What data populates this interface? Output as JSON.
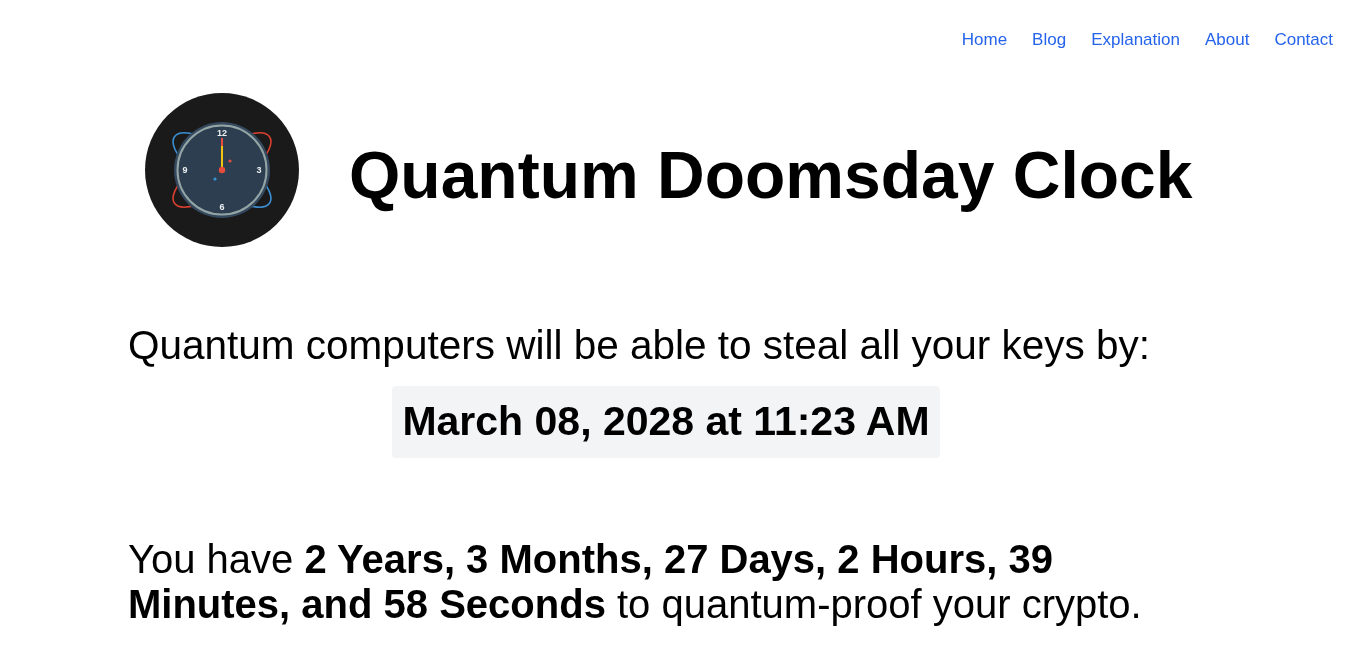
{
  "nav": {
    "links": [
      "Home",
      "Blog",
      "Explanation",
      "About",
      "Contact"
    ]
  },
  "header": {
    "logo": {
      "dial_numbers": [
        "12",
        "3",
        "6",
        "9"
      ]
    },
    "title": "Quantum Doomsday Clock"
  },
  "prediction": {
    "lead": "Quantum computers will be able to steal all your keys by:",
    "date": "March 08, 2028 at 11:23 AM"
  },
  "countdown": {
    "text": "You have **2 Years, 3 Months, 27 Days, 2 Hours, 39 Minutes, and 58 Seconds** to quantum-proof your crypto."
  }
}
